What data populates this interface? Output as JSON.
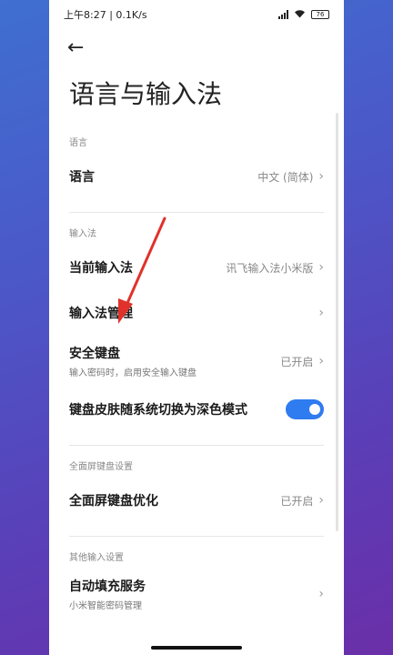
{
  "status_bar": {
    "time": "上午8:27",
    "speed": "0.1K/s",
    "battery": "76"
  },
  "page": {
    "title": "语言与输入法"
  },
  "sections": {
    "language": {
      "header": "语言",
      "row_label": "语言",
      "row_value": "中文 (简体)"
    },
    "input_method": {
      "header": "输入法",
      "current_label": "当前输入法",
      "current_value": "讯飞输入法小米版",
      "manage_label": "输入法管理",
      "secure_label": "安全键盘",
      "secure_sub": "输入密码时，启用安全输入键盘",
      "secure_value": "已开启",
      "dark_label": "键盘皮肤随系统切换为深色模式",
      "dark_enabled": true
    },
    "fullscreen": {
      "header": "全面屏键盘设置",
      "optimize_label": "全面屏键盘优化",
      "optimize_value": "已开启"
    },
    "other": {
      "header": "其他输入设置",
      "autofill_label": "自动填充服务",
      "autofill_sub": "小米智能密码管理"
    }
  },
  "colors": {
    "accent": "#2f7bf0",
    "arrow": "#e0322a"
  }
}
